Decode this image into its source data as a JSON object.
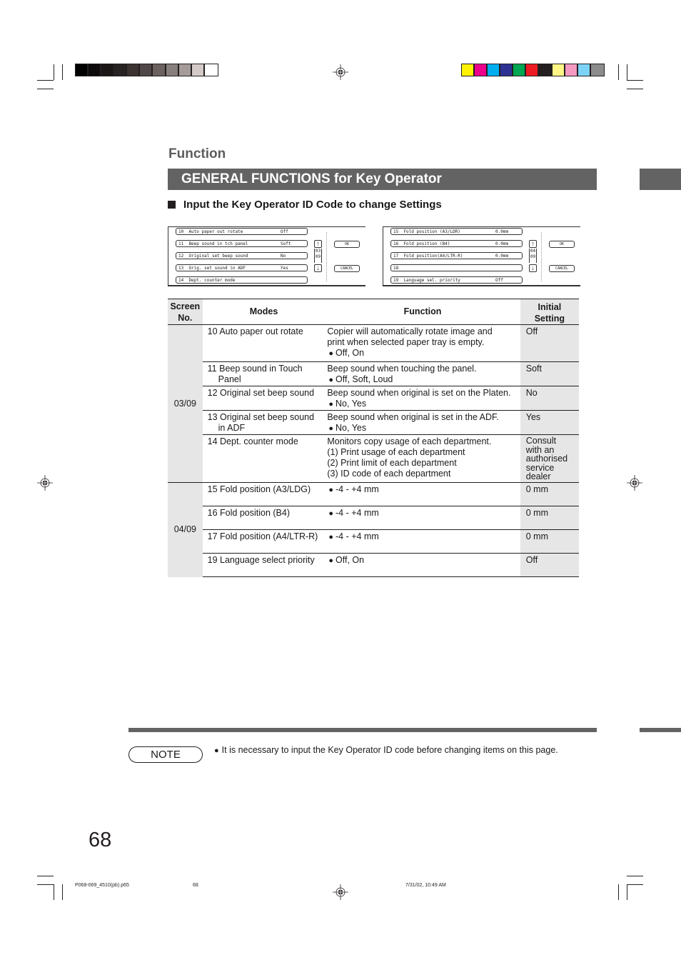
{
  "header": {
    "section_label": "Function",
    "title": "GENERAL FUNCTIONS for Key Operator",
    "subheading": "Input the Key Operator ID Code to change Settings"
  },
  "print_marks": {
    "gray_swatches": [
      "#000000",
      "#0c0a0a",
      "#1a1616",
      "#272322",
      "#3b3332",
      "#504848",
      "#6b615f",
      "#877f7d",
      "#a59c99",
      "#d4cbc9",
      "#ffffff"
    ],
    "color_swatches": [
      "#fff200",
      "#ec008c",
      "#00aeef",
      "#2e3192",
      "#00a651",
      "#ed1c24",
      "#231f20",
      "#fff685",
      "#f49ac1",
      "#7dd3f7",
      "#8c8c8c"
    ]
  },
  "screens": [
    {
      "page": [
        "03",
        "09"
      ],
      "fields": [
        {
          "label": "10  Auto paper out rotate",
          "value": "Off"
        },
        {
          "label": "11  Beep sound in tch panel",
          "value": "Soft"
        },
        {
          "label": "12  Original set beep sound",
          "value": "No"
        },
        {
          "label": "13  Orig. set sound in ADF",
          "value": "Yes"
        },
        {
          "label": "14  Dept. counter mode",
          "value": ""
        }
      ],
      "ok_label": "OK",
      "cancel_label": "CANCEL"
    },
    {
      "page": [
        "04",
        "09"
      ],
      "fields": [
        {
          "label": "15  Fold position (A3/LDR)",
          "value": "0.0mm"
        },
        {
          "label": "16  Fold position (B4)",
          "value": "0.0mm"
        },
        {
          "label": "17  Fold position(A4/LTR-R)",
          "value": "0.0mm"
        },
        {
          "label": "18",
          "value": ""
        },
        {
          "label": "19  Language sel. priority",
          "value": "Off"
        }
      ],
      "ok_label": "OK",
      "cancel_label": "CANCEL"
    }
  ],
  "table": {
    "headers": {
      "screen": [
        "Screen",
        "No."
      ],
      "modes": "Modes",
      "function": "Function",
      "initial": [
        "Initial",
        "Setting"
      ]
    },
    "groups": [
      {
        "screen": "03/09",
        "rows": [
          {
            "mode": [
              "10 Auto paper out rotate"
            ],
            "function": [
              "Copier will automatically rotate image and",
              "print when selected paper tray is empty."
            ],
            "options": "Off, On",
            "initial": [
              "Off"
            ]
          },
          {
            "mode": [
              "11 Beep sound in Touch",
              "Panel"
            ],
            "function": [
              "Beep sound when touching the panel."
            ],
            "options": "Off, Soft, Loud",
            "initial": [
              "Soft"
            ]
          },
          {
            "mode": [
              "12 Original set beep sound"
            ],
            "function": [
              "Beep sound when original is set on the Platen."
            ],
            "options": "No, Yes",
            "initial": [
              "No"
            ]
          },
          {
            "mode": [
              "13 Original set beep sound",
              "in ADF"
            ],
            "function": [
              "Beep sound when original is set in the ADF."
            ],
            "options": "No, Yes",
            "initial": [
              "Yes"
            ]
          },
          {
            "mode": [
              "14 Dept. counter mode"
            ],
            "function": [
              "Monitors copy usage of each department.",
              "(1) Print usage of each department",
              "(2) Print limit of each department",
              "(3) ID code of each department"
            ],
            "options": "",
            "initial": [
              "Consult",
              "with an",
              "authorised",
              "service",
              "dealer"
            ]
          }
        ]
      },
      {
        "screen": "04/09",
        "rows": [
          {
            "mode": [
              "15 Fold position (A3/LDG)"
            ],
            "function": [],
            "options": "-4 - +4 mm",
            "initial": [
              "0 mm"
            ]
          },
          {
            "mode": [
              "16 Fold position (B4)"
            ],
            "function": [],
            "options": "-4 - +4 mm",
            "initial": [
              "0 mm"
            ]
          },
          {
            "mode": [
              "17 Fold position (A4/LTR-R)"
            ],
            "function": [],
            "options": "-4 - +4 mm",
            "initial": [
              "0 mm"
            ]
          },
          {
            "mode": [
              "19 Language select priority"
            ],
            "function": [],
            "options": "Off, On",
            "initial": [
              "Off"
            ]
          }
        ]
      }
    ]
  },
  "note": {
    "label": "NOTE",
    "text": "It is necessary to input the Key Operator ID code before changing items on this page."
  },
  "page_number": "68",
  "footer": {
    "file": "P068-069_4510(pb).p65",
    "page": "68",
    "timestamp": "7/31/02, 10:49 AM"
  }
}
